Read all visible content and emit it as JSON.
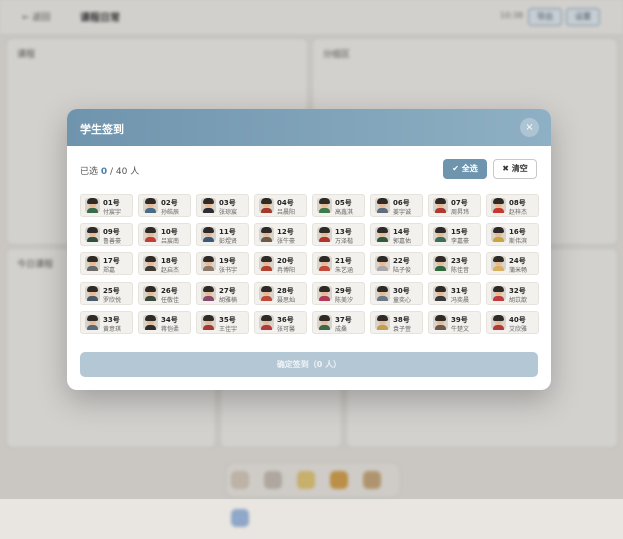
{
  "background": {
    "back_label": "← 返回",
    "page_title": "课程日常",
    "time_text": "10:38",
    "btn_one": "导出",
    "btn_two": "设置",
    "panel_left_title": "课程",
    "panel_right_title": "分组区",
    "panel_lower_title": "今日课程"
  },
  "modal": {
    "title": "学生签到",
    "close_symbol": "×",
    "selected_prefix": "已选",
    "selected_count": "0",
    "selected_suffix": "/ 40 人",
    "select_all_label": "✔ 全选",
    "clear_label": "✖ 清空",
    "confirm_label": "确定签到（0 人）"
  },
  "students": [
    {
      "no": "01号",
      "name": "付宸宇",
      "shirt": "#3a6a4a"
    },
    {
      "no": "02号",
      "name": "孙皓辰",
      "shirt": "#4a6a8a"
    },
    {
      "no": "03号",
      "name": "张琼宸",
      "shirt": "#2d2d35"
    },
    {
      "no": "04号",
      "name": "吕晨阳",
      "shirt": "#a33a2a"
    },
    {
      "no": "05号",
      "name": "高鑫淇",
      "shirt": "#3f7a4a"
    },
    {
      "no": "06号",
      "name": "姜宇诚",
      "shirt": "#5d6d7d"
    },
    {
      "no": "07号",
      "name": "周昇玮",
      "shirt": "#b03a30"
    },
    {
      "no": "08号",
      "name": "赵梓杰",
      "shirt": "#c7382e"
    },
    {
      "no": "09号",
      "name": "鲁善豪",
      "shirt": "#2f4f3f"
    },
    {
      "no": "10号",
      "name": "吕宸南",
      "shirt": "#c23d33"
    },
    {
      "no": "11号",
      "name": "彭煜贤",
      "shirt": "#3b5a7a"
    },
    {
      "no": "12号",
      "name": "张牛豪",
      "shirt": "#6b5a4a"
    },
    {
      "no": "13号",
      "name": "万泽楷",
      "shirt": "#b1332e"
    },
    {
      "no": "14号",
      "name": "郭嘉佑",
      "shirt": "#2e5a3e"
    },
    {
      "no": "15号",
      "name": "李嘉豪",
      "shirt": "#3b6f5a"
    },
    {
      "no": "16号",
      "name": "斯伟滨",
      "shirt": "#c8a640"
    },
    {
      "no": "17号",
      "name": "郑嘉",
      "shirt": "#6a6a6a"
    },
    {
      "no": "18号",
      "name": "赵启杰",
      "shirt": "#403a35"
    },
    {
      "no": "19号",
      "name": "张书宇",
      "shirt": "#8a7a6a"
    },
    {
      "no": "20号",
      "name": "冉博阳",
      "shirt": "#b33f2f"
    },
    {
      "no": "21号",
      "name": "朱艺涵",
      "shirt": "#c34a3a"
    },
    {
      "no": "22号",
      "name": "陆子俊",
      "shirt": "#a8a8a8"
    },
    {
      "no": "23号",
      "name": "陈佳音",
      "shirt": "#2f6a3f"
    },
    {
      "no": "24号",
      "name": "蒲米畅",
      "shirt": "#d7b060"
    },
    {
      "no": "25号",
      "name": "罗欣悦",
      "shirt": "#4a5a6a"
    },
    {
      "no": "26号",
      "name": "任敬佳",
      "shirt": "#3a4a3a"
    },
    {
      "no": "27号",
      "name": "胡雅楠",
      "shirt": "#8a4a6a"
    },
    {
      "no": "28号",
      "name": "聂思灿",
      "shirt": "#c04a3a"
    },
    {
      "no": "29号",
      "name": "陈美汐",
      "shirt": "#b13a5a"
    },
    {
      "no": "30号",
      "name": "童奕心",
      "shirt": "#6a7a8a"
    },
    {
      "no": "31号",
      "name": "冯奕晨",
      "shirt": "#3a3a3a"
    },
    {
      "no": "32号",
      "name": "胡苡歆",
      "shirt": "#c03a40"
    },
    {
      "no": "33号",
      "name": "黄意琪",
      "shirt": "#5a6a7a"
    },
    {
      "no": "34号",
      "name": "蒋恺柔",
      "shirt": "#2d2d2d"
    },
    {
      "no": "35号",
      "name": "王佳宇",
      "shirt": "#a33a3a"
    },
    {
      "no": "36号",
      "name": "张可馨",
      "shirt": "#b03a40"
    },
    {
      "no": "37号",
      "name": "成桑",
      "shirt": "#3a6a4a"
    },
    {
      "no": "38号",
      "name": "袁子萱",
      "shirt": "#c0a050"
    },
    {
      "no": "39号",
      "name": "牛楚文",
      "shirt": "#6a5a4a"
    },
    {
      "no": "40号",
      "name": "艾欣雅",
      "shirt": "#b43a3a"
    }
  ],
  "dock_icons": [
    "home-icon",
    "checkin-icon",
    "star-icon",
    "trophy-icon",
    "box-icon",
    "chart-icon"
  ]
}
